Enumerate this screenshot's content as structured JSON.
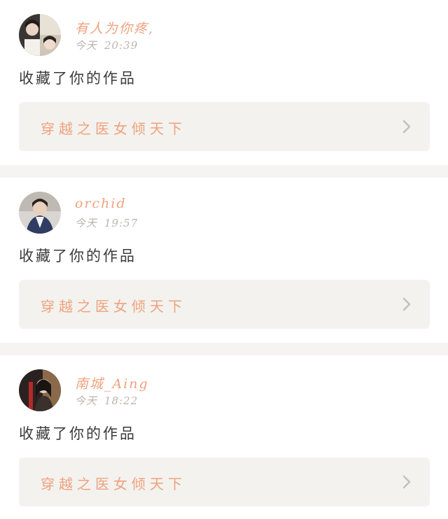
{
  "feed": {
    "items": [
      {
        "username": "有人为你疼,",
        "date_label": "今天",
        "time": "20:39",
        "action": "收藏了你的作品",
        "work_title": "穿越之医女倾天下"
      },
      {
        "username": "orchid",
        "date_label": "今天",
        "time": "19:57",
        "action": "收藏了你的作品",
        "work_title": "穿越之医女倾天下"
      },
      {
        "username": "南城_Aing",
        "date_label": "今天",
        "time": "18:22",
        "action": "收藏了你的作品",
        "work_title": "穿越之医女倾天下"
      }
    ]
  },
  "icons": {
    "chevron": "chevron-right-icon",
    "avatar": "avatar"
  },
  "colors": {
    "accent": "#f0a27e",
    "muted": "#b9b5b1",
    "card_bg": "#f3f2ee",
    "divider": "#f6f4f3",
    "text": "#3a3a3a"
  }
}
